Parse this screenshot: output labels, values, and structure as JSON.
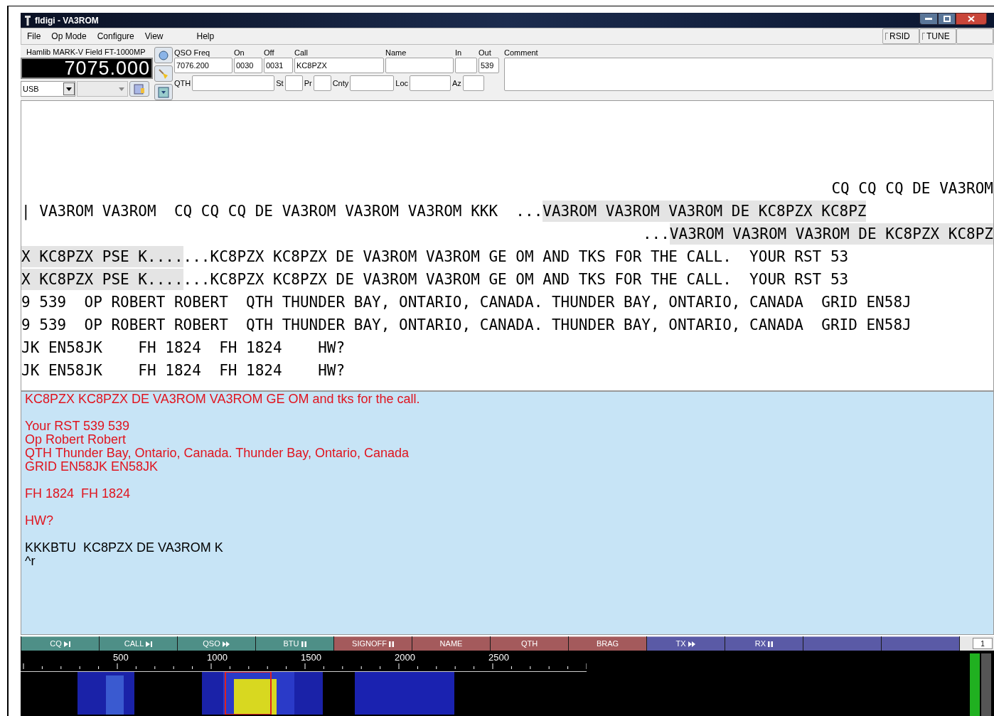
{
  "window": {
    "title": "fldigi - VA3ROM"
  },
  "menu": [
    "File",
    "Op Mode",
    "Configure",
    "View",
    "Help"
  ],
  "toggles": [
    {
      "label": "RSID",
      "on": false
    },
    {
      "label": "TUNE",
      "on": false
    }
  ],
  "rig": {
    "name": "Hamlib MARK-V Field FT-1000MP",
    "frequency": "7075.000",
    "mode": "USB"
  },
  "log_row1": [
    {
      "label": "QSO Freq",
      "value": "7076.200"
    },
    {
      "label": "On",
      "value": "0030"
    },
    {
      "label": "Off",
      "value": "0031"
    },
    {
      "label": "Call",
      "value": "KC8PZX"
    },
    {
      "label": "Name"
    },
    {
      "label": "In"
    },
    {
      "label": "Out",
      "value": "539"
    }
  ],
  "log_row2": [
    {
      "label": "QTH"
    },
    {
      "label": "St"
    },
    {
      "label": "Pr"
    },
    {
      "label": "Cnty"
    },
    {
      "label": "Loc"
    },
    {
      "label": "Az"
    }
  ],
  "comment": {
    "label": "Comment"
  },
  "rx_lines": [
    {
      "kind": "trailing",
      "segments": [
        {
          "text": "CQ CQ CQ DE VA3ROM",
          "shaded": false
        }
      ]
    },
    {
      "kind": "leading",
      "segments": [
        {
          "text": "| VA3ROM VA3ROM  CQ CQ CQ DE VA3ROM VA3ROM VA3ROM KKK  ...",
          "shaded": false
        },
        {
          "text": "VA3ROM VA3ROM VA3ROM DE KC8PZX KC8PZ",
          "shaded": true
        }
      ]
    },
    {
      "kind": "trailing",
      "segments": [
        {
          "text": "...",
          "shaded": false
        },
        {
          "text": "VA3ROM VA3ROM VA3ROM DE KC8PZX KC8PZ",
          "shaded": true
        }
      ]
    },
    {
      "kind": "leading",
      "segments": [
        {
          "text": "X KC8PZX PSE K....",
          "shaded": true
        },
        {
          "text": "...KC8PZX KC8PZX DE VA3ROM VA3ROM GE OM AND TKS FOR THE CALL.  YOUR RST 53",
          "shaded": false
        }
      ]
    },
    {
      "kind": "leading",
      "segments": [
        {
          "text": "X KC8PZX PSE K....",
          "shaded": true
        },
        {
          "text": "...KC8PZX KC8PZX DE VA3ROM VA3ROM GE OM AND TKS FOR THE CALL.  YOUR RST 53",
          "shaded": false
        }
      ]
    },
    {
      "kind": "leading",
      "segments": [
        {
          "text": "9 539  OP ROBERT ROBERT  QTH THUNDER BAY, ONTARIO, CANADA. THUNDER BAY, ONTARIO, CANADA  GRID EN58J",
          "shaded": false
        }
      ]
    },
    {
      "kind": "leading",
      "segments": [
        {
          "text": "9 539  OP ROBERT ROBERT  QTH THUNDER BAY, ONTARIO, CANADA. THUNDER BAY, ONTARIO, CANADA  GRID EN58J",
          "shaded": false
        }
      ]
    },
    {
      "kind": "leading",
      "segments": [
        {
          "text": "JK EN58JK    FH 1824  FH 1824    HW?",
          "shaded": false
        }
      ]
    },
    {
      "kind": "leading",
      "segments": [
        {
          "text": "JK EN58JK    FH 1824  FH 1824    HW?",
          "shaded": false
        }
      ]
    }
  ],
  "tx_paragraphs": [
    {
      "kind": "sent",
      "lines": [
        "KC8PZX KC8PZX DE VA3ROM VA3ROM GE OM and tks for the call."
      ]
    },
    {
      "kind": "sent",
      "lines": [
        "Your RST 539 539",
        "Op Robert Robert",
        "QTH Thunder Bay, Ontario, Canada. Thunder Bay, Ontario, Canada",
        "GRID EN58JK EN58JK"
      ]
    },
    {
      "kind": "sent",
      "lines": [
        "FH 1824  FH 1824"
      ]
    },
    {
      "kind": "sent",
      "lines": [
        "HW?"
      ]
    },
    {
      "kind": "queued",
      "lines": [
        "KKKBTU  KC8PZX DE VA3ROM K",
        "^r"
      ]
    }
  ],
  "macros": [
    {
      "label": "CQ",
      "kind": "playstop",
      "color": "#4e8f87"
    },
    {
      "label": "CALL",
      "kind": "playstop",
      "color": "#4e8f87"
    },
    {
      "label": "QSO",
      "kind": "forward",
      "color": "#4e8f87"
    },
    {
      "label": "BTU",
      "kind": "pause",
      "color": "#4e8f87"
    },
    {
      "label": "SIGNOFF",
      "kind": "pause",
      "color": "#a45a5c"
    },
    {
      "label": "NAME",
      "kind": "plain",
      "color": "#a45a5c"
    },
    {
      "label": "QTH",
      "kind": "plain",
      "color": "#a45a5c"
    },
    {
      "label": "BRAG",
      "kind": "plain",
      "color": "#a45a5c"
    },
    {
      "label": "TX",
      "kind": "forward",
      "color": "#5a5aa6"
    },
    {
      "label": "RX",
      "kind": "pause",
      "color": "#5a5aa6"
    },
    {
      "kind": "plain",
      "color": "#5a5aa6"
    },
    {
      "kind": "plain",
      "color": "#5a5aa6"
    }
  ],
  "macro_set": "1",
  "waterfall": {
    "scale": [
      "500",
      "1000",
      "1500",
      "2000",
      "2500"
    ]
  }
}
